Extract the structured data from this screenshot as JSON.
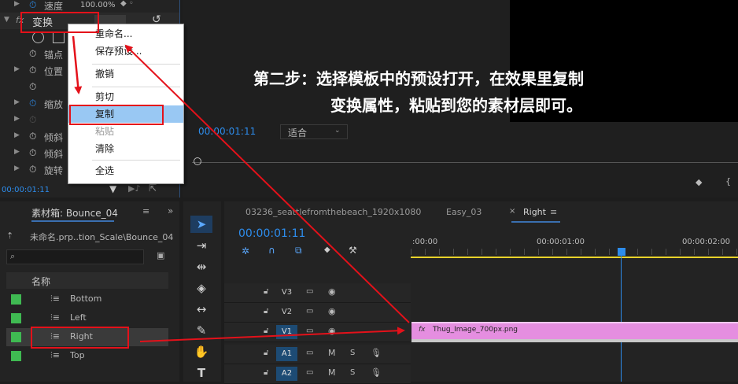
{
  "effect_controls": {
    "speed_label": "速度",
    "speed_value": "100.00%",
    "transform_label": "变换",
    "fx_badge": "fx",
    "anchor_label": "锚点",
    "position_label": "位置",
    "scale_label": "缩放",
    "skew1_label": "倾斜",
    "skew2_label": "倾斜",
    "rotate_label": "旋转",
    "timecode": "00:00:01:11"
  },
  "context_menu": {
    "items": [
      "重命名...",
      "保存预设...",
      "撤销",
      "剪切",
      "复制",
      "粘贴",
      "清除",
      "全选"
    ],
    "highlighted": "复制",
    "disabled": "粘贴"
  },
  "program_monitor": {
    "timecode": "00:00:01:11",
    "fit_label": "适合",
    "caption_line1": "第二步：选择模板中的预设打开，在效果里复制",
    "caption_line2": "变换属性，粘贴到您的素材层即可。"
  },
  "project": {
    "tab_title": "素材箱: Bounce_04",
    "path": "未命名.prp..tion_Scale\\Bounce_04",
    "column_name": "名称",
    "items": [
      "Bottom",
      "Left",
      "Right",
      "Top"
    ],
    "swatch_color": "#3fba52"
  },
  "timeline": {
    "tabs": [
      "03236_seattlefromthebeach_1920x1080",
      "Easy_03",
      "Right"
    ],
    "active_tab": "Right",
    "timecode": "00:00:01:11",
    "ruler": [
      ":00:00",
      "00:00:01:00",
      "00:00:02:00"
    ],
    "tracks": [
      "V3",
      "V2",
      "V1",
      "A1",
      "A2"
    ],
    "track_m": "M",
    "track_s": "S",
    "clip_name": "Thug_Image_700px.png",
    "clip_fx": "fx",
    "clip_color": "#e58ee0"
  },
  "colors": {
    "accent": "#2d8ceb",
    "highlight_red": "#e4111a"
  }
}
